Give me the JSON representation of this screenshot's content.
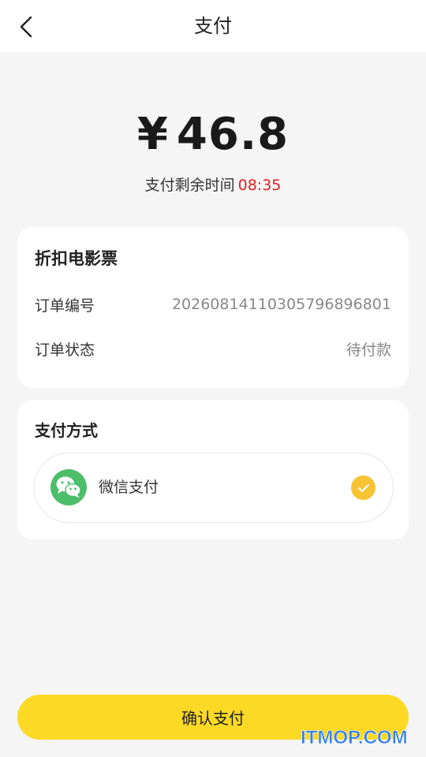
{
  "header": {
    "title": "支付",
    "back_icon": "chevron-left-icon"
  },
  "payment": {
    "currency_symbol": "¥",
    "amount": "46.8",
    "remaining_label": "支付剩余时间",
    "remaining_time": "08:35",
    "time_color": "#e02020"
  },
  "order": {
    "title": "折扣电影票",
    "number_label": "订单编号",
    "number_value": "2026081411030579689680 1",
    "status_label": "订单状态",
    "status_value": "待付款"
  },
  "pay_method": {
    "title": "支付方式",
    "options": [
      {
        "name": "微信支付",
        "icon": "wechat-icon",
        "selected": true
      }
    ]
  },
  "actions": {
    "confirm_label": "确认支付",
    "confirm_color": "#fcd925"
  },
  "watermark": {
    "text": "ITMOP.COM",
    "color": "#2f7cf0"
  }
}
